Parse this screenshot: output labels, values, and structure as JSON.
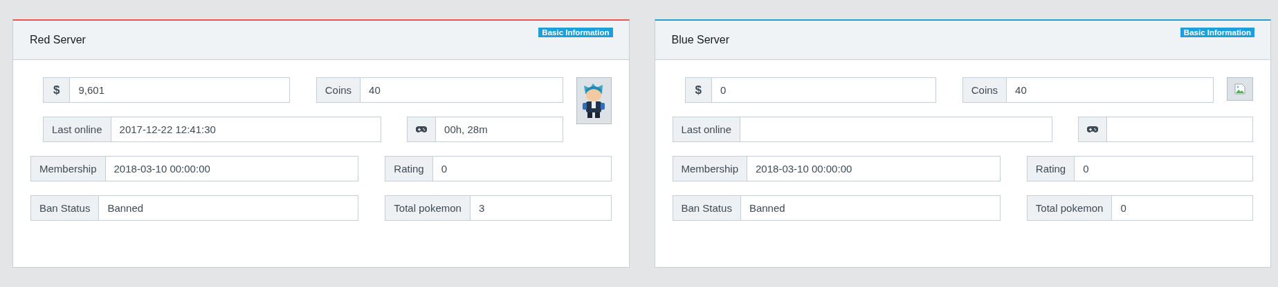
{
  "servers": [
    {
      "title": "Red Server",
      "color": "#f05050",
      "badge": "Basic Information",
      "avatar": {
        "kind": "sprite"
      },
      "fields": [
        {
          "kind": "symbol",
          "label": "$",
          "value": "9,601"
        },
        {
          "kind": "text",
          "label": "Coins",
          "value": "40"
        },
        {
          "kind": "text",
          "label": "Last online",
          "value": "2017-12-22 12:41:30"
        },
        {
          "kind": "gamepad",
          "value": "00h, 28m"
        },
        {
          "kind": "text",
          "label": "Membership",
          "value": "2018-03-10 00:00:00"
        },
        {
          "kind": "text",
          "label": "Rating",
          "value": "0"
        },
        {
          "kind": "text",
          "label": "Ban Status",
          "value": "Banned"
        },
        {
          "kind": "text",
          "label": "Total pokemon",
          "value": "3"
        }
      ]
    },
    {
      "title": "Blue Server",
      "color": "#1e9fd8",
      "badge": "Basic Information",
      "avatar": {
        "kind": "broken"
      },
      "fields": [
        {
          "kind": "symbol",
          "label": "$",
          "value": "0"
        },
        {
          "kind": "text",
          "label": "Coins",
          "value": "40"
        },
        {
          "kind": "text",
          "label": "Last online"
        },
        {
          "kind": "gamepad"
        },
        {
          "kind": "text",
          "label": "Membership",
          "value": "2018-03-10 00:00:00"
        },
        {
          "kind": "text",
          "label": "Rating",
          "value": "0"
        },
        {
          "kind": "text",
          "label": "Ban Status",
          "value": "Banned"
        },
        {
          "kind": "text",
          "label": "Total pokemon",
          "value": "0"
        }
      ]
    }
  ]
}
